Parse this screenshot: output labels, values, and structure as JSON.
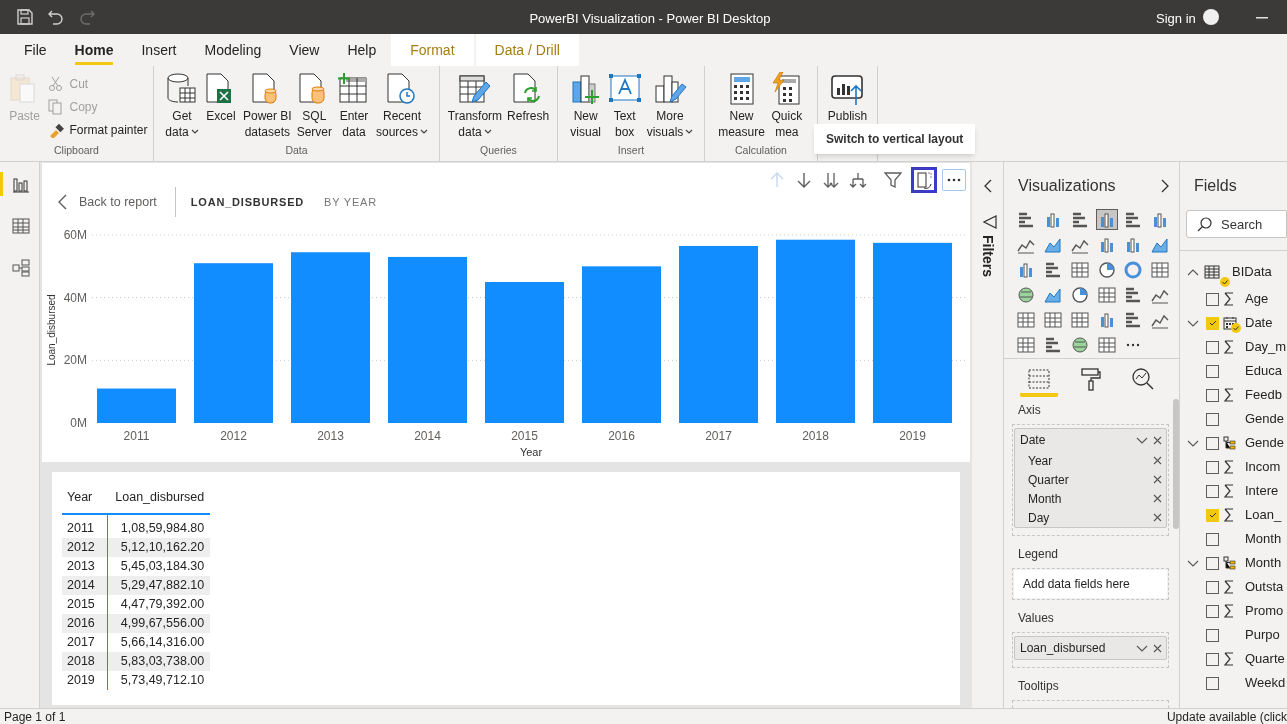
{
  "window": {
    "title": "PowerBI Visualization - Power BI Desktop",
    "sign_in": "Sign in"
  },
  "ribbon_tabs": [
    {
      "label": "File",
      "kind": "plain",
      "selected": false
    },
    {
      "label": "Home",
      "kind": "plain",
      "selected": true
    },
    {
      "label": "Insert",
      "kind": "plain",
      "selected": false
    },
    {
      "label": "Modeling",
      "kind": "plain",
      "selected": false
    },
    {
      "label": "View",
      "kind": "plain",
      "selected": false
    },
    {
      "label": "Help",
      "kind": "plain",
      "selected": false
    },
    {
      "label": "Format",
      "kind": "contextual",
      "selected": false
    },
    {
      "label": "Data / Drill",
      "kind": "contextual",
      "selected": false
    }
  ],
  "ribbon_groups": [
    {
      "label": "Clipboard",
      "buttons": [
        {
          "kind": "large",
          "lines": [
            "Paste"
          ],
          "disabled": true,
          "dropdown": false
        },
        {
          "kind": "small",
          "lines": [
            "Cut"
          ],
          "disabled": true
        },
        {
          "kind": "small",
          "lines": [
            "Copy"
          ],
          "disabled": true
        },
        {
          "kind": "small",
          "lines": [
            "Format painter"
          ],
          "disabled": false
        }
      ]
    },
    {
      "label": "Data",
      "buttons": [
        {
          "kind": "large",
          "lines": [
            "Get",
            "data"
          ],
          "disabled": false,
          "dropdown": true
        },
        {
          "kind": "large",
          "lines": [
            "Excel"
          ],
          "disabled": false,
          "dropdown": false
        },
        {
          "kind": "large",
          "lines": [
            "Power BI",
            "datasets"
          ],
          "disabled": false,
          "dropdown": false
        },
        {
          "kind": "large",
          "lines": [
            "SQL",
            "Server"
          ],
          "disabled": false,
          "dropdown": false
        },
        {
          "kind": "large",
          "lines": [
            "Enter",
            "data"
          ],
          "disabled": false,
          "dropdown": false
        },
        {
          "kind": "large",
          "lines": [
            "Recent",
            "sources"
          ],
          "disabled": false,
          "dropdown": true
        }
      ]
    },
    {
      "label": "Queries",
      "buttons": [
        {
          "kind": "large",
          "lines": [
            "Transform",
            "data"
          ],
          "disabled": false,
          "dropdown": true
        },
        {
          "kind": "large",
          "lines": [
            "Refresh"
          ],
          "disabled": false,
          "dropdown": false
        }
      ]
    },
    {
      "label": "Insert",
      "buttons": [
        {
          "kind": "large",
          "lines": [
            "New",
            "visual"
          ],
          "disabled": false,
          "dropdown": false
        },
        {
          "kind": "large",
          "lines": [
            "Text",
            "box"
          ],
          "disabled": false,
          "dropdown": false
        },
        {
          "kind": "large",
          "lines": [
            "More",
            "visuals"
          ],
          "disabled": false,
          "dropdown": true
        }
      ]
    },
    {
      "label": "Calculation",
      "buttons": [
        {
          "kind": "large",
          "lines": [
            "New",
            "measure"
          ],
          "disabled": false,
          "dropdown": false
        },
        {
          "kind": "large",
          "lines": [
            "Quick",
            "mea"
          ],
          "disabled": false,
          "dropdown": false
        }
      ]
    },
    {
      "buttons": [
        {
          "kind": "large",
          "lines": [
            "Publish"
          ],
          "disabled": false,
          "dropdown": false
        }
      ]
    }
  ],
  "tooltip": "Switch to vertical layout",
  "left_nav": [
    {
      "selected": true
    },
    {
      "selected": false
    },
    {
      "selected": false
    }
  ],
  "visual_header": {
    "back": "Back to report",
    "measure": "LOAN_DISBURSED",
    "by": "BY YEAR"
  },
  "chart_data": {
    "type": "bar",
    "xlabel": "Year",
    "ylabel": "Loan_disbursed",
    "categories": [
      "2011",
      "2012",
      "2013",
      "2014",
      "2015",
      "2016",
      "2017",
      "2018",
      "2019"
    ],
    "values": [
      11000000,
      51000000,
      54500000,
      53000000,
      45000000,
      50000000,
      56500000,
      58500000,
      57500000
    ],
    "ylim": [
      0,
      60000000
    ],
    "yticks": [
      {
        "value": 0,
        "label": "0M"
      },
      {
        "value": 20000000,
        "label": "20M"
      },
      {
        "value": 40000000,
        "label": "40M"
      },
      {
        "value": 60000000,
        "label": "60M"
      }
    ]
  },
  "table": {
    "columns": [
      "Year",
      "Loan_disbursed"
    ],
    "rows": [
      [
        "2011",
        "1,08,59,984.80"
      ],
      [
        "2012",
        "5,12,10,162.20"
      ],
      [
        "2013",
        "5,45,03,184.30"
      ],
      [
        "2014",
        "5,29,47,882.10"
      ],
      [
        "2015",
        "4,47,79,392.00"
      ],
      [
        "2016",
        "4,99,67,556.00"
      ],
      [
        "2017",
        "5,66,14,316.00"
      ],
      [
        "2018",
        "5,83,03,738.00"
      ],
      [
        "2019",
        "5,73,49,712.10"
      ]
    ]
  },
  "filters": {
    "title": "Filters"
  },
  "visualizations": {
    "title": "Visualizations",
    "gallery": [
      {
        "selected": false
      },
      {
        "selected": false
      },
      {
        "selected": false
      },
      {
        "selected": true
      },
      {
        "selected": false
      },
      {
        "selected": false
      },
      {
        "selected": false
      },
      {
        "selected": false
      },
      {
        "selected": false
      },
      {
        "selected": false
      },
      {
        "selected": false
      },
      {
        "selected": false
      },
      {
        "selected": false
      },
      {
        "selected": false
      },
      {
        "selected": false
      },
      {
        "selected": false
      },
      {
        "selected": false
      },
      {
        "selected": false
      },
      {
        "selected": false
      },
      {
        "selected": false
      },
      {
        "selected": false
      },
      {
        "selected": false
      },
      {
        "selected": false
      },
      {
        "selected": false
      },
      {
        "selected": false
      },
      {
        "selected": false
      },
      {
        "selected": false
      },
      {
        "selected": false
      },
      {
        "selected": false
      },
      {
        "selected": false
      },
      {
        "selected": false
      },
      {
        "selected": false
      },
      {
        "selected": false
      },
      {
        "selected": false
      }
    ],
    "pane_tabs": [
      {
        "selected": true
      },
      {
        "selected": false
      },
      {
        "selected": false
      }
    ],
    "wells": [
      {
        "label": "Axis",
        "fields": [
          {
            "name": "Date",
            "subfields": [
              "Year",
              "Quarter",
              "Month",
              "Day"
            ]
          }
        ]
      },
      {
        "label": "Legend",
        "placeholder": "Add data fields here"
      },
      {
        "label": "Values",
        "fields": [
          {
            "name": "Loan_disbursed"
          }
        ]
      },
      {
        "label": "Tooltips"
      }
    ]
  },
  "fields": {
    "title": "Fields",
    "search": {
      "placeholder": "Search"
    },
    "tree": [
      {
        "name": "BIData",
        "kind": "table",
        "expanded": true,
        "children": [
          {
            "name": "Age",
            "kind": "measure",
            "checked": false
          },
          {
            "name": "Date",
            "kind": "date",
            "checked": true,
            "expanded": false
          },
          {
            "name": "Day_m",
            "kind": "measure",
            "checked": false
          },
          {
            "name": "Educa",
            "kind": "text",
            "checked": false
          },
          {
            "name": "Feedb",
            "kind": "measure",
            "checked": false
          },
          {
            "name": "Gende",
            "kind": "text",
            "checked": false
          },
          {
            "name": "Gende",
            "kind": "hierarchy",
            "checked": false,
            "expanded": false
          },
          {
            "name": "Incom",
            "kind": "measure",
            "checked": false
          },
          {
            "name": "Intere",
            "kind": "measure",
            "checked": false
          },
          {
            "name": "Loan_",
            "kind": "measure",
            "checked": true
          },
          {
            "name": "Month",
            "kind": "text",
            "checked": false
          },
          {
            "name": "Month",
            "kind": "hierarchy",
            "checked": false,
            "expanded": false
          },
          {
            "name": "Outsta",
            "kind": "measure",
            "checked": false
          },
          {
            "name": "Promo",
            "kind": "measure",
            "checked": false
          },
          {
            "name": "Purpo",
            "kind": "text",
            "checked": false
          },
          {
            "name": "Quarte",
            "kind": "measure",
            "checked": false
          },
          {
            "name": "Weekd",
            "kind": "text",
            "checked": false
          }
        ]
      }
    ]
  },
  "status_bar": {
    "page": "Page 1 of 1",
    "update": "Update available (click"
  }
}
